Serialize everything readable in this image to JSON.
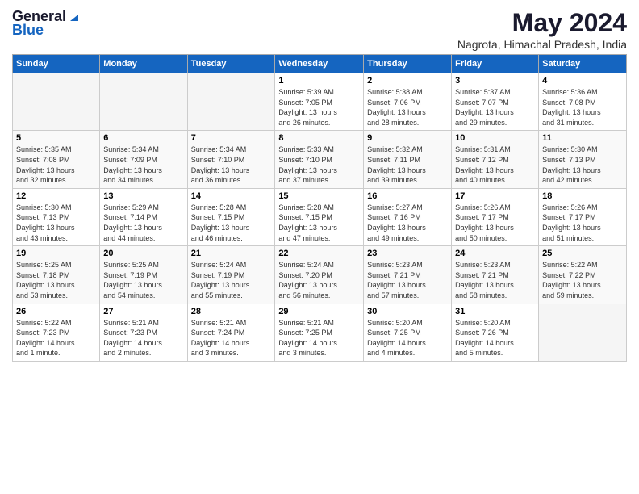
{
  "logo": {
    "general": "General",
    "blue": "Blue"
  },
  "title": "May 2024",
  "subtitle": "Nagrota, Himachal Pradesh, India",
  "weekdays": [
    "Sunday",
    "Monday",
    "Tuesday",
    "Wednesday",
    "Thursday",
    "Friday",
    "Saturday"
  ],
  "weeks": [
    [
      {
        "day": "",
        "info": ""
      },
      {
        "day": "",
        "info": ""
      },
      {
        "day": "",
        "info": ""
      },
      {
        "day": "1",
        "info": "Sunrise: 5:39 AM\nSunset: 7:05 PM\nDaylight: 13 hours\nand 26 minutes."
      },
      {
        "day": "2",
        "info": "Sunrise: 5:38 AM\nSunset: 7:06 PM\nDaylight: 13 hours\nand 28 minutes."
      },
      {
        "day": "3",
        "info": "Sunrise: 5:37 AM\nSunset: 7:07 PM\nDaylight: 13 hours\nand 29 minutes."
      },
      {
        "day": "4",
        "info": "Sunrise: 5:36 AM\nSunset: 7:08 PM\nDaylight: 13 hours\nand 31 minutes."
      }
    ],
    [
      {
        "day": "5",
        "info": "Sunrise: 5:35 AM\nSunset: 7:08 PM\nDaylight: 13 hours\nand 32 minutes."
      },
      {
        "day": "6",
        "info": "Sunrise: 5:34 AM\nSunset: 7:09 PM\nDaylight: 13 hours\nand 34 minutes."
      },
      {
        "day": "7",
        "info": "Sunrise: 5:34 AM\nSunset: 7:10 PM\nDaylight: 13 hours\nand 36 minutes."
      },
      {
        "day": "8",
        "info": "Sunrise: 5:33 AM\nSunset: 7:10 PM\nDaylight: 13 hours\nand 37 minutes."
      },
      {
        "day": "9",
        "info": "Sunrise: 5:32 AM\nSunset: 7:11 PM\nDaylight: 13 hours\nand 39 minutes."
      },
      {
        "day": "10",
        "info": "Sunrise: 5:31 AM\nSunset: 7:12 PM\nDaylight: 13 hours\nand 40 minutes."
      },
      {
        "day": "11",
        "info": "Sunrise: 5:30 AM\nSunset: 7:13 PM\nDaylight: 13 hours\nand 42 minutes."
      }
    ],
    [
      {
        "day": "12",
        "info": "Sunrise: 5:30 AM\nSunset: 7:13 PM\nDaylight: 13 hours\nand 43 minutes."
      },
      {
        "day": "13",
        "info": "Sunrise: 5:29 AM\nSunset: 7:14 PM\nDaylight: 13 hours\nand 44 minutes."
      },
      {
        "day": "14",
        "info": "Sunrise: 5:28 AM\nSunset: 7:15 PM\nDaylight: 13 hours\nand 46 minutes."
      },
      {
        "day": "15",
        "info": "Sunrise: 5:28 AM\nSunset: 7:15 PM\nDaylight: 13 hours\nand 47 minutes."
      },
      {
        "day": "16",
        "info": "Sunrise: 5:27 AM\nSunset: 7:16 PM\nDaylight: 13 hours\nand 49 minutes."
      },
      {
        "day": "17",
        "info": "Sunrise: 5:26 AM\nSunset: 7:17 PM\nDaylight: 13 hours\nand 50 minutes."
      },
      {
        "day": "18",
        "info": "Sunrise: 5:26 AM\nSunset: 7:17 PM\nDaylight: 13 hours\nand 51 minutes."
      }
    ],
    [
      {
        "day": "19",
        "info": "Sunrise: 5:25 AM\nSunset: 7:18 PM\nDaylight: 13 hours\nand 53 minutes."
      },
      {
        "day": "20",
        "info": "Sunrise: 5:25 AM\nSunset: 7:19 PM\nDaylight: 13 hours\nand 54 minutes."
      },
      {
        "day": "21",
        "info": "Sunrise: 5:24 AM\nSunset: 7:19 PM\nDaylight: 13 hours\nand 55 minutes."
      },
      {
        "day": "22",
        "info": "Sunrise: 5:24 AM\nSunset: 7:20 PM\nDaylight: 13 hours\nand 56 minutes."
      },
      {
        "day": "23",
        "info": "Sunrise: 5:23 AM\nSunset: 7:21 PM\nDaylight: 13 hours\nand 57 minutes."
      },
      {
        "day": "24",
        "info": "Sunrise: 5:23 AM\nSunset: 7:21 PM\nDaylight: 13 hours\nand 58 minutes."
      },
      {
        "day": "25",
        "info": "Sunrise: 5:22 AM\nSunset: 7:22 PM\nDaylight: 13 hours\nand 59 minutes."
      }
    ],
    [
      {
        "day": "26",
        "info": "Sunrise: 5:22 AM\nSunset: 7:23 PM\nDaylight: 14 hours\nand 1 minute."
      },
      {
        "day": "27",
        "info": "Sunrise: 5:21 AM\nSunset: 7:23 PM\nDaylight: 14 hours\nand 2 minutes."
      },
      {
        "day": "28",
        "info": "Sunrise: 5:21 AM\nSunset: 7:24 PM\nDaylight: 14 hours\nand 3 minutes."
      },
      {
        "day": "29",
        "info": "Sunrise: 5:21 AM\nSunset: 7:25 PM\nDaylight: 14 hours\nand 3 minutes."
      },
      {
        "day": "30",
        "info": "Sunrise: 5:20 AM\nSunset: 7:25 PM\nDaylight: 14 hours\nand 4 minutes."
      },
      {
        "day": "31",
        "info": "Sunrise: 5:20 AM\nSunset: 7:26 PM\nDaylight: 14 hours\nand 5 minutes."
      },
      {
        "day": "",
        "info": ""
      }
    ]
  ]
}
